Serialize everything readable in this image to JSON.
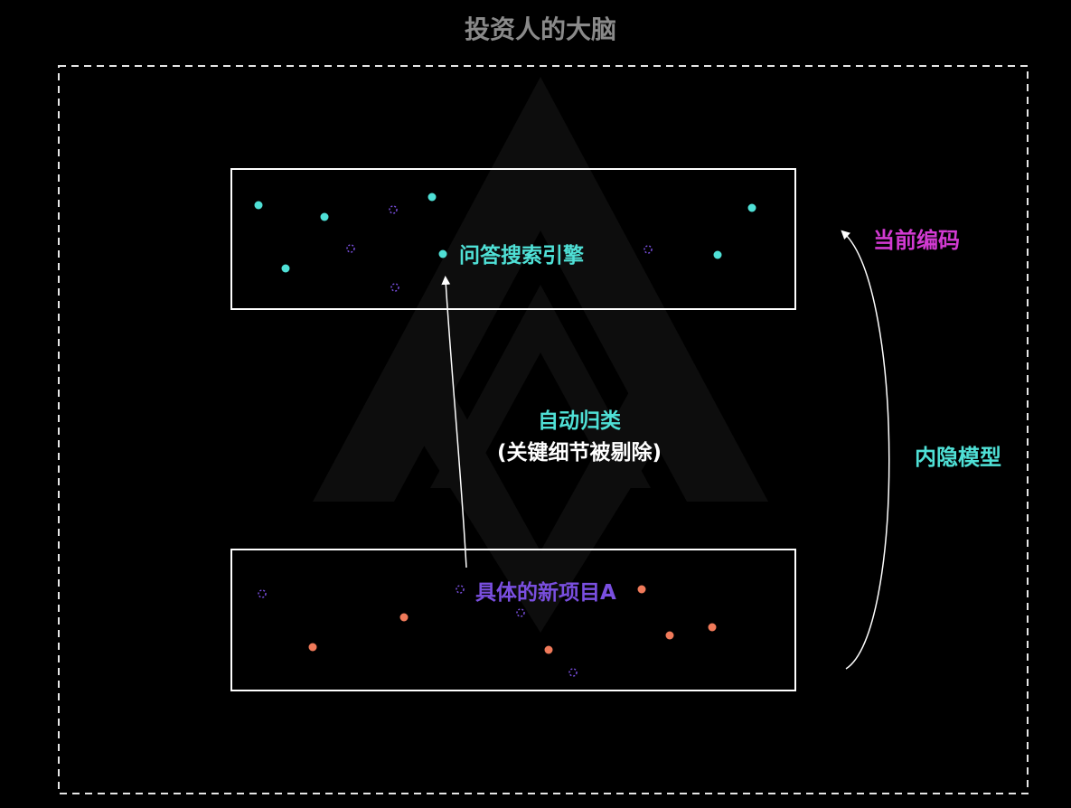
{
  "title": "投资人的大脑",
  "top_box": {
    "label": "问答搜索引擎"
  },
  "bottom_box": {
    "label": "具体的新项目A"
  },
  "middle": {
    "line1": "自动归类",
    "line2": "(关键细节被剔除)"
  },
  "right": {
    "upper_label": "当前编码",
    "lower_label": "内隐模型"
  },
  "colors": {
    "background": "#000000",
    "title": "#8a8a8a",
    "cyan": "#4fe0d6",
    "magenta": "#d23ad2",
    "purple": "#7a4fe0",
    "orange": "#f07a5a",
    "white": "#ffffff"
  }
}
